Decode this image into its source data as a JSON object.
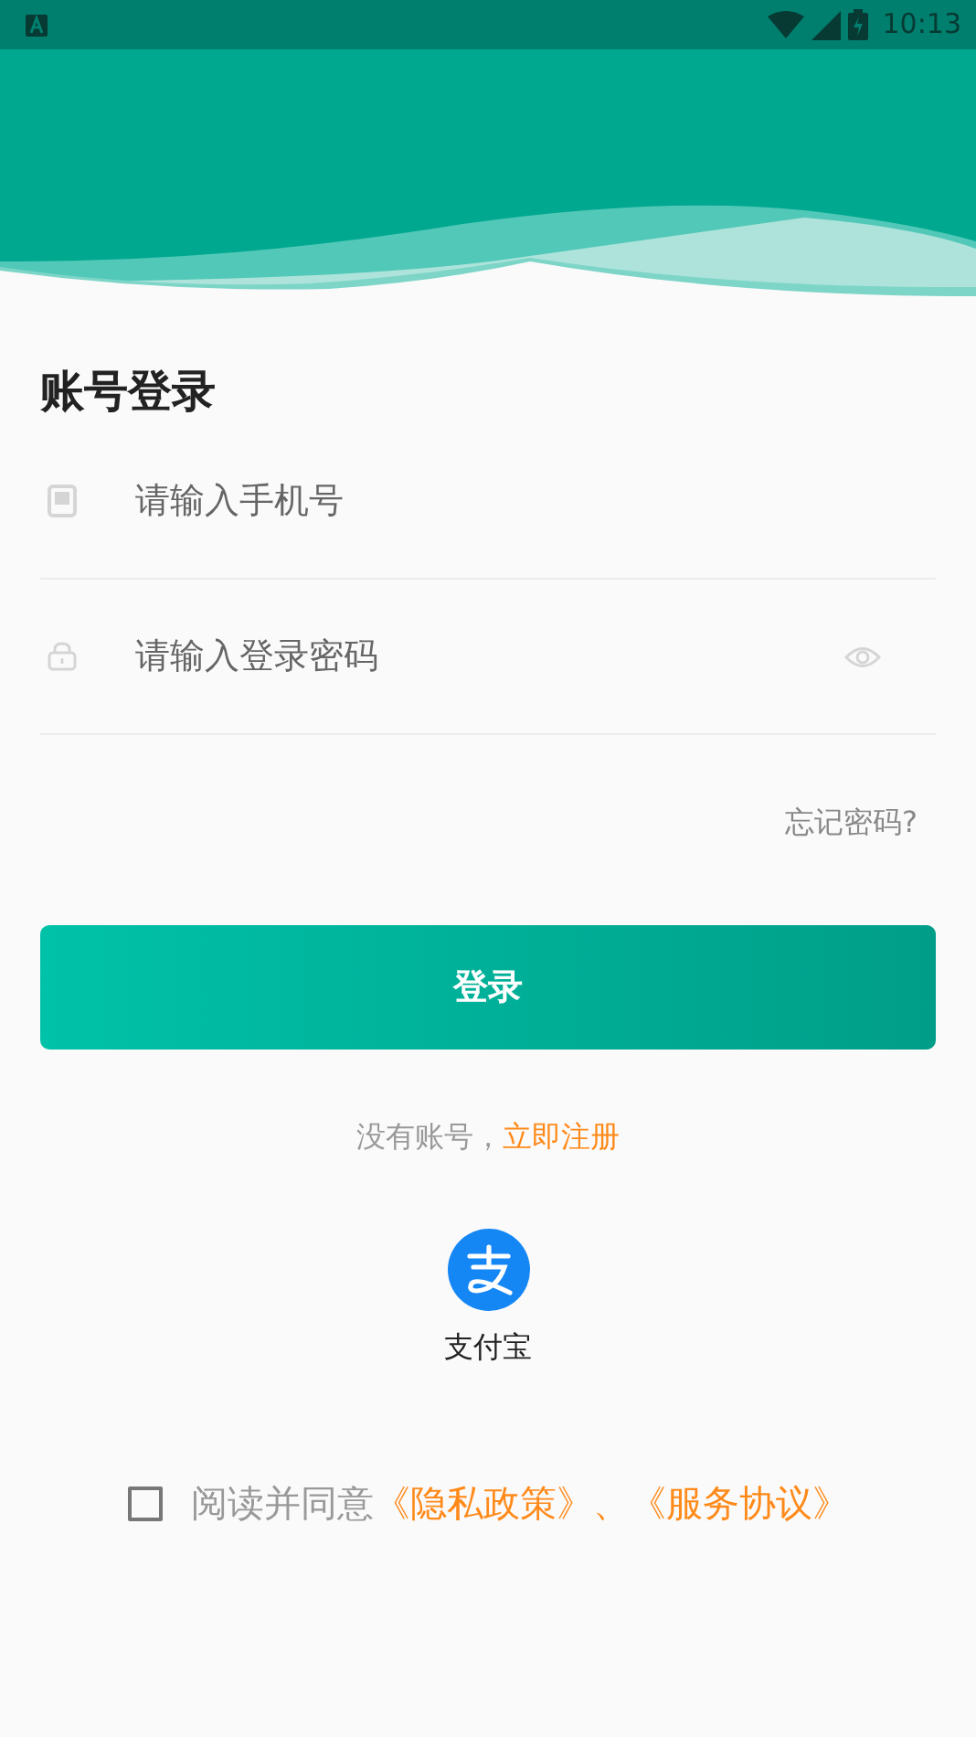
{
  "status_bar": {
    "time": "10:13"
  },
  "title": "账号登录",
  "fields": [
    {
      "kind": "phone",
      "placeholder": "请输入手机号"
    },
    {
      "kind": "password",
      "placeholder": "请输入登录密码"
    }
  ],
  "forgot_link": "忘记密码?",
  "login_button": "登录",
  "register": {
    "prompt": "没有账号，",
    "link": "立即注册"
  },
  "third_party": [
    {
      "label": "支付宝"
    }
  ],
  "agreement": {
    "checked": false,
    "prefix": "阅读并同意",
    "links": [
      "《隐私政策》",
      "《服务协议》"
    ],
    "separator": "、"
  }
}
